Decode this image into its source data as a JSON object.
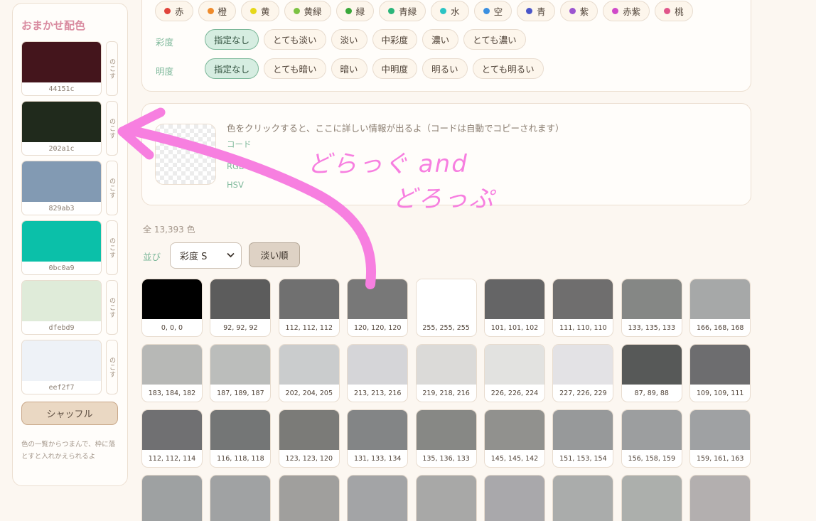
{
  "sidebar": {
    "title": "おまかせ配色",
    "keep_label": "のこす",
    "swatches": [
      {
        "code": "44151c",
        "color": "#44151c"
      },
      {
        "code": "202a1c",
        "color": "#202a1c"
      },
      {
        "code": "829ab3",
        "color": "#829ab3"
      },
      {
        "code": "0bc0a9",
        "color": "#0bc0a9"
      },
      {
        "code": "dfebd9",
        "color": "#dfebd9"
      },
      {
        "code": "eef2f7",
        "color": "#eef2f7"
      }
    ],
    "shuffle_label": "シャッフル",
    "hint": "色の一覧からつまんで、枠に落とすと入れかえられるよ"
  },
  "filters": {
    "hues": [
      {
        "label": "赤",
        "color": "#e0433a"
      },
      {
        "label": "橙",
        "color": "#ef8b2b"
      },
      {
        "label": "黄",
        "color": "#e6d81a"
      },
      {
        "label": "黄緑",
        "color": "#7cc242"
      },
      {
        "label": "緑",
        "color": "#3aa83a"
      },
      {
        "label": "青緑",
        "color": "#2bb57a"
      },
      {
        "label": "水",
        "color": "#2bc4c4"
      },
      {
        "label": "空",
        "color": "#3a8fe0"
      },
      {
        "label": "青",
        "color": "#4a56c9"
      },
      {
        "label": "紫",
        "color": "#9b55d0"
      },
      {
        "label": "赤紫",
        "color": "#d04ac9"
      },
      {
        "label": "桃",
        "color": "#e0558a"
      }
    ],
    "saturation_label": "彩度",
    "saturation_options": [
      "指定なし",
      "とても淡い",
      "淡い",
      "中彩度",
      "濃い",
      "とても濃い"
    ],
    "brightness_label": "明度",
    "brightness_options": [
      "指定なし",
      "とても暗い",
      "暗い",
      "中明度",
      "明るい",
      "とても明るい"
    ]
  },
  "info": {
    "message": "色をクリックすると、ここに詳しい情報が出るよ（コードは自動でコピーされます）",
    "label_code": "コード",
    "label_rgb": "RGB",
    "label_hsv": "HSV"
  },
  "list": {
    "count": "全 13,393 色",
    "sort_label": "並び",
    "sort_value": "彩度 S",
    "order_label": "淡い順",
    "colors": [
      {
        "rgb": "0, 0, 0"
      },
      {
        "rgb": "92, 92, 92"
      },
      {
        "rgb": "112, 112, 112"
      },
      {
        "rgb": "120, 120, 120"
      },
      {
        "rgb": "255, 255, 255"
      },
      {
        "rgb": "101, 101, 102"
      },
      {
        "rgb": "111, 110, 110"
      },
      {
        "rgb": "133, 135, 133"
      },
      {
        "rgb": "166, 168, 168"
      },
      {
        "rgb": "183, 184, 182"
      },
      {
        "rgb": "187, 189, 187"
      },
      {
        "rgb": "202, 204, 205"
      },
      {
        "rgb": "213, 213, 216"
      },
      {
        "rgb": "219, 218, 216"
      },
      {
        "rgb": "226, 226, 224"
      },
      {
        "rgb": "227, 226, 229"
      },
      {
        "rgb": "87, 89, 88"
      },
      {
        "rgb": "109, 109, 111"
      },
      {
        "rgb": "112, 112, 114"
      },
      {
        "rgb": "116, 118, 118"
      },
      {
        "rgb": "123, 123, 120"
      },
      {
        "rgb": "131, 133, 134"
      },
      {
        "rgb": "135, 136, 133"
      },
      {
        "rgb": "145, 145, 142"
      },
      {
        "rgb": "151, 153, 154"
      },
      {
        "rgb": "156, 158, 159"
      },
      {
        "rgb": "159, 161, 163"
      }
    ],
    "partial_colors": [
      "#9ea1a2",
      "#a0a2a3",
      "#a09f9d",
      "#a3a4a6",
      "#a8a8a7",
      "#a9a8ab",
      "#aaacab",
      "#acafac",
      "#b3afaf"
    ]
  },
  "annotation": {
    "line1": "どらっぐ and",
    "line2": "どろっぷ",
    "color": "#f77fe0"
  }
}
